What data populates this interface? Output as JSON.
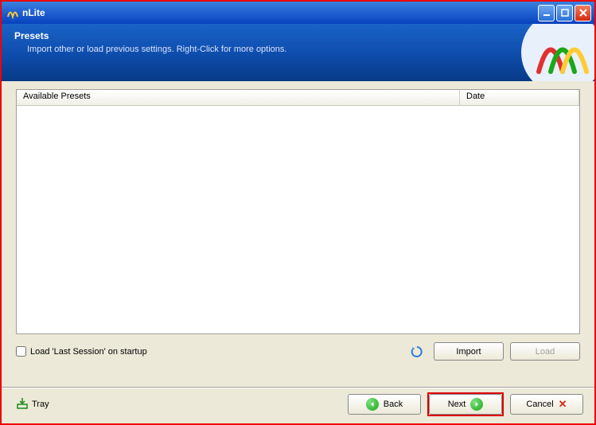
{
  "window": {
    "title": "nLite"
  },
  "header": {
    "title": "Presets",
    "description": "Import other or load previous settings. Right-Click for more options."
  },
  "list": {
    "columns": {
      "presets": "Available Presets",
      "date": "Date"
    },
    "rows": []
  },
  "options": {
    "loadLastSession": {
      "label": "Load 'Last Session' on startup",
      "checked": false
    }
  },
  "buttons": {
    "import": "Import",
    "load": "Load",
    "tray": "Tray",
    "back": "Back",
    "next": "Next",
    "cancel": "Cancel"
  }
}
